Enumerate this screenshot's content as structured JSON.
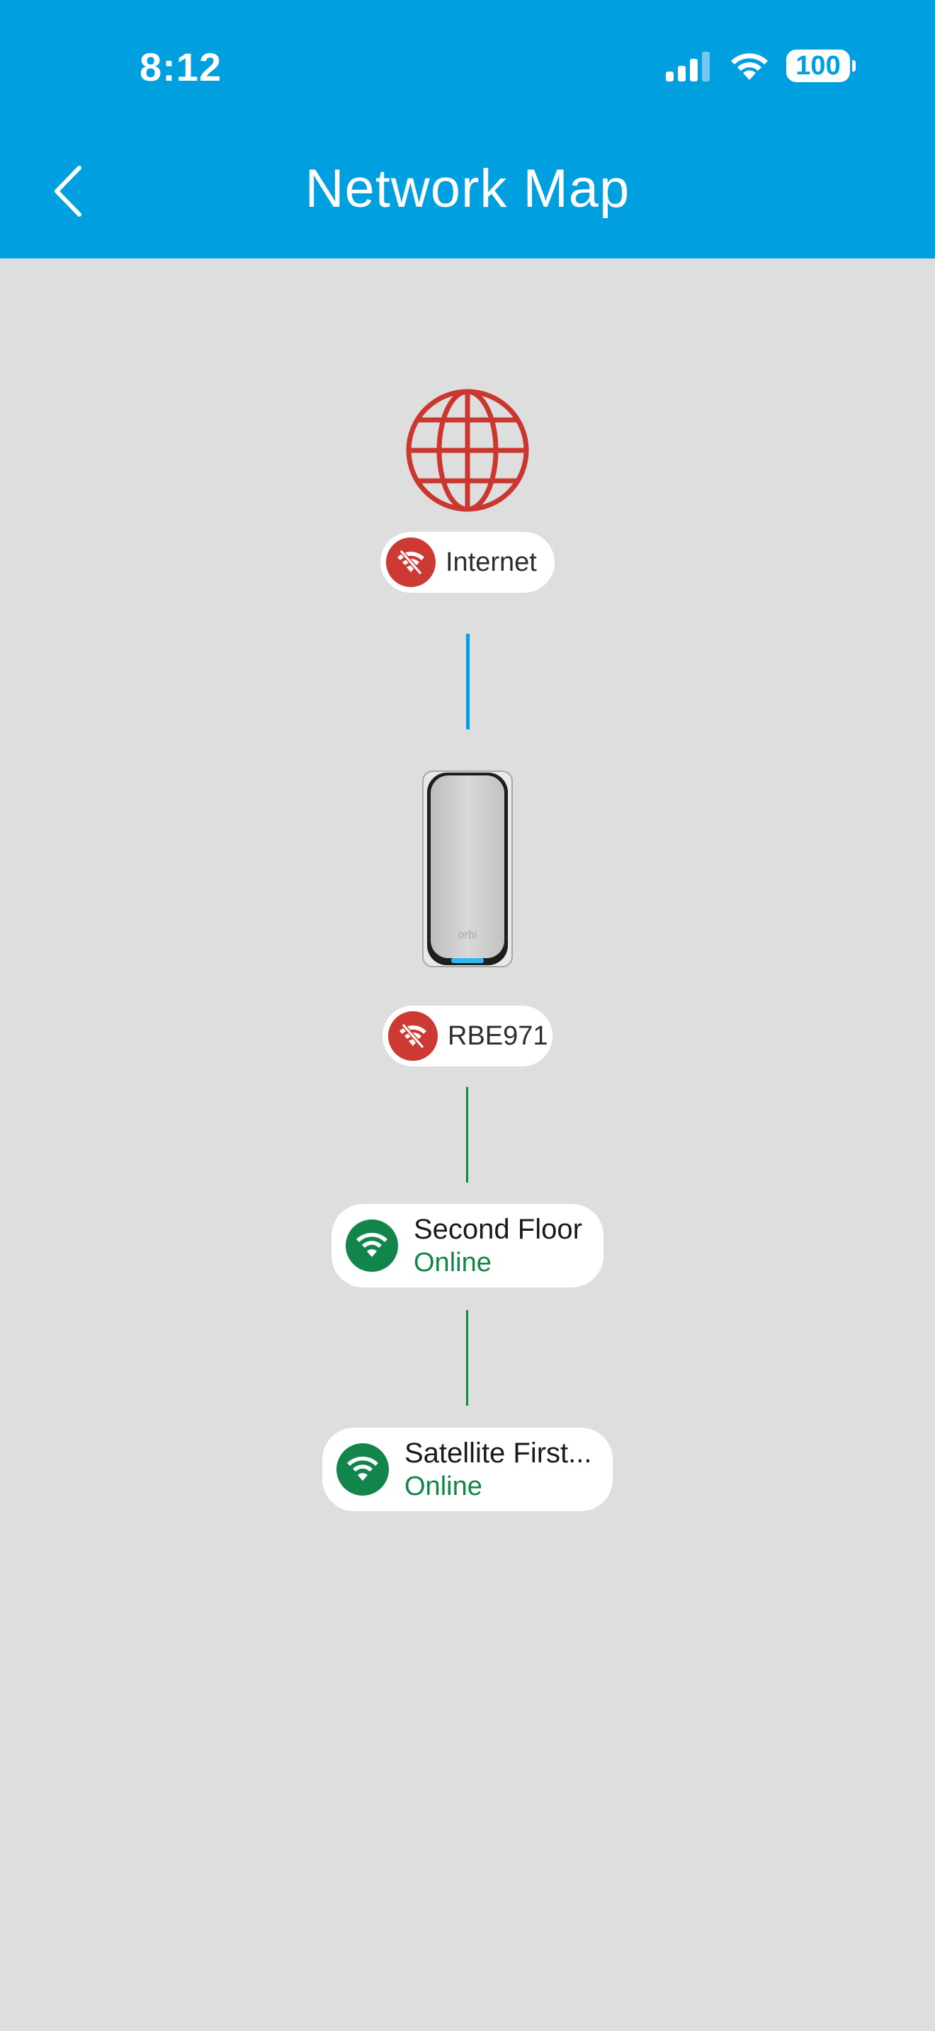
{
  "status_bar": {
    "time": "8:12",
    "battery": "100"
  },
  "header": {
    "title": "Network Map"
  },
  "nodes": {
    "internet": {
      "label": "Internet"
    },
    "router": {
      "label": "RBE971"
    },
    "satellite_1": {
      "name": "Second Floor",
      "status": "Online"
    },
    "satellite_2": {
      "name": "Satellite First...",
      "status": "Online"
    }
  },
  "colors": {
    "header": "#009fdf",
    "background": "#dedede",
    "offline": "#cd3a34",
    "online": "#12864a",
    "wired_link": "#009fdf",
    "wireless_link": "#12864a"
  },
  "icons": {
    "internet_status": "wifi-off-icon",
    "router_status": "wifi-off-icon",
    "satellite_status": "wifi-icon"
  }
}
